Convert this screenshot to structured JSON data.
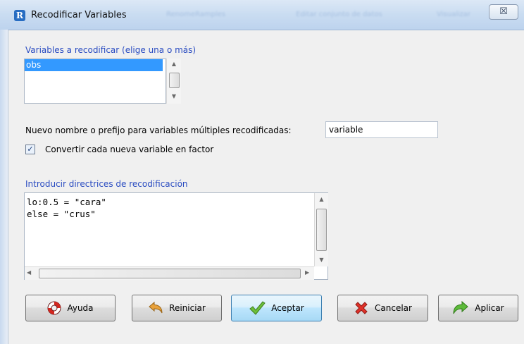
{
  "window": {
    "title": "Recodificar Variables",
    "close_glyph": "☒",
    "background_titles": [
      "RenomeRamples",
      "Editar conjunto de datos",
      "Visualizar"
    ]
  },
  "variables_section": {
    "label": "Variables a recodificar (elige una o más)",
    "items": [
      {
        "label": "obs",
        "selected": true
      }
    ]
  },
  "new_name": {
    "label": "Nuevo nombre o prefijo para variables múltiples recodificadas:",
    "value": "variable"
  },
  "factor_checkbox": {
    "label": "Convertir cada nueva variable en factor",
    "checked": true,
    "check_glyph": "✓"
  },
  "directives": {
    "label": "Introducir directrices de recodificación",
    "lines": [
      "lo:0.5 = \"cara\"",
      "else = \"crus\""
    ]
  },
  "buttons": {
    "help": "Ayuda",
    "reset": "Reiniciar",
    "ok": "Aceptar",
    "cancel": "Cancelar",
    "apply": "Aplicar"
  },
  "icons": {
    "app": "r-logo-icon",
    "help": "lifebuoy-icon",
    "reset": "undo-arrow-icon",
    "ok": "checkmark-icon",
    "cancel": "x-icon",
    "apply": "forward-arrow-icon"
  }
}
